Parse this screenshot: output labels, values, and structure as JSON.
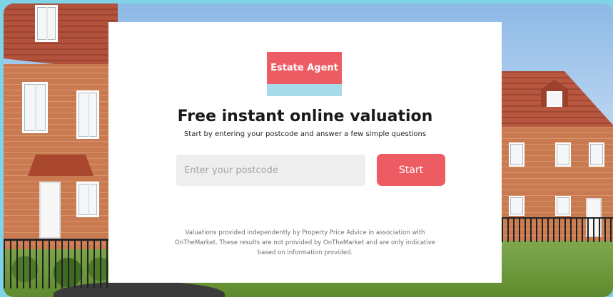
{
  "logo": {
    "text": "Estate Agent"
  },
  "heading": {
    "title": "Free instant online valuation",
    "subtitle": "Start by entering your postcode and answer a few simple questions"
  },
  "form": {
    "postcode_placeholder": "Enter your postcode",
    "postcode_value": "",
    "start_label": "Start"
  },
  "disclaimer": {
    "text": "Valuations provided independently by Property Price Advice in association with OnTheMarket. These results are not provided by OnTheMarket and are only indicative based on information provided."
  },
  "colors": {
    "accent": "#ee5c63",
    "logo_stripe": "#a8dbea",
    "frame": "#7fd3e6",
    "input_bg": "#eeeeef"
  }
}
